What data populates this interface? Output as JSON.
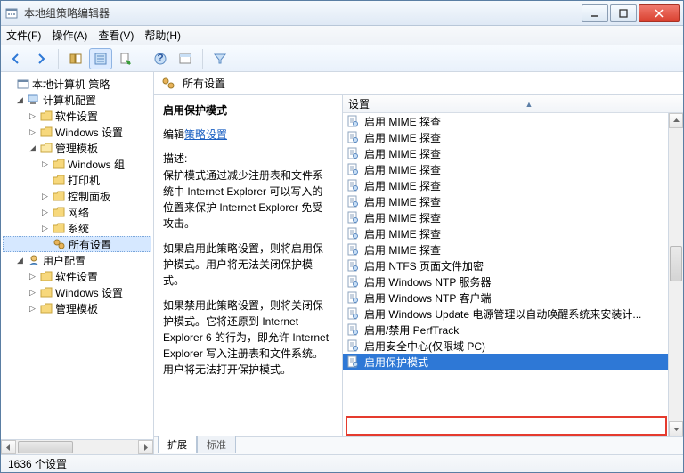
{
  "window": {
    "title": "本地组策略编辑器"
  },
  "menu": {
    "file": "文件(F)",
    "action": "操作(A)",
    "view": "查看(V)",
    "help": "帮助(H)"
  },
  "tree": {
    "root": "本地计算机 策略",
    "computer_config": "计算机配置",
    "software_settings": "软件设置",
    "windows_settings": "Windows 设置",
    "admin_templates": "管理模板",
    "windows_components": "Windows 组",
    "printers": "打印机",
    "control_panel": "控制面板",
    "network": "网络",
    "system": "系统",
    "all_settings": "所有设置",
    "user_config": "用户配置",
    "software_settings2": "软件设置",
    "windows_settings2": "Windows 设置",
    "admin_templates2": "管理模板"
  },
  "header": {
    "title": "所有设置"
  },
  "description": {
    "title": "启用保护模式",
    "edit_prefix": "编辑",
    "edit_link": "策略设置",
    "label": "描述:",
    "p1": "保护模式通过减少注册表和文件系统中 Internet Explorer 可以写入的位置来保护 Internet Explorer 免受攻击。",
    "p2": "如果启用此策略设置，则将启用保护模式。用户将无法关闭保护模式。",
    "p3": "如果禁用此策略设置，则将关闭保护模式。它将还原到 Internet Explorer 6 的行为，即允许 Internet Explorer 写入注册表和文件系统。用户将无法打开保护模式。"
  },
  "column": {
    "settings": "设置"
  },
  "items": [
    "启用 MIME 探查",
    "启用 MIME 探查",
    "启用 MIME 探查",
    "启用 MIME 探查",
    "启用 MIME 探查",
    "启用 MIME 探查",
    "启用 MIME 探查",
    "启用 MIME 探查",
    "启用 MIME 探查",
    "启用 NTFS 页面文件加密",
    "启用 Windows NTP 服务器",
    "启用 Windows NTP 客户端",
    "启用 Windows Update 电源管理以自动唤醒系统来安装计...",
    "启用/禁用 PerfTrack",
    "启用安全中心(仅限域 PC)",
    "启用保护模式"
  ],
  "selected_index": 15,
  "tabs": {
    "extended": "扩展",
    "standard": "标准"
  },
  "status": {
    "count": "1636 个设置"
  }
}
